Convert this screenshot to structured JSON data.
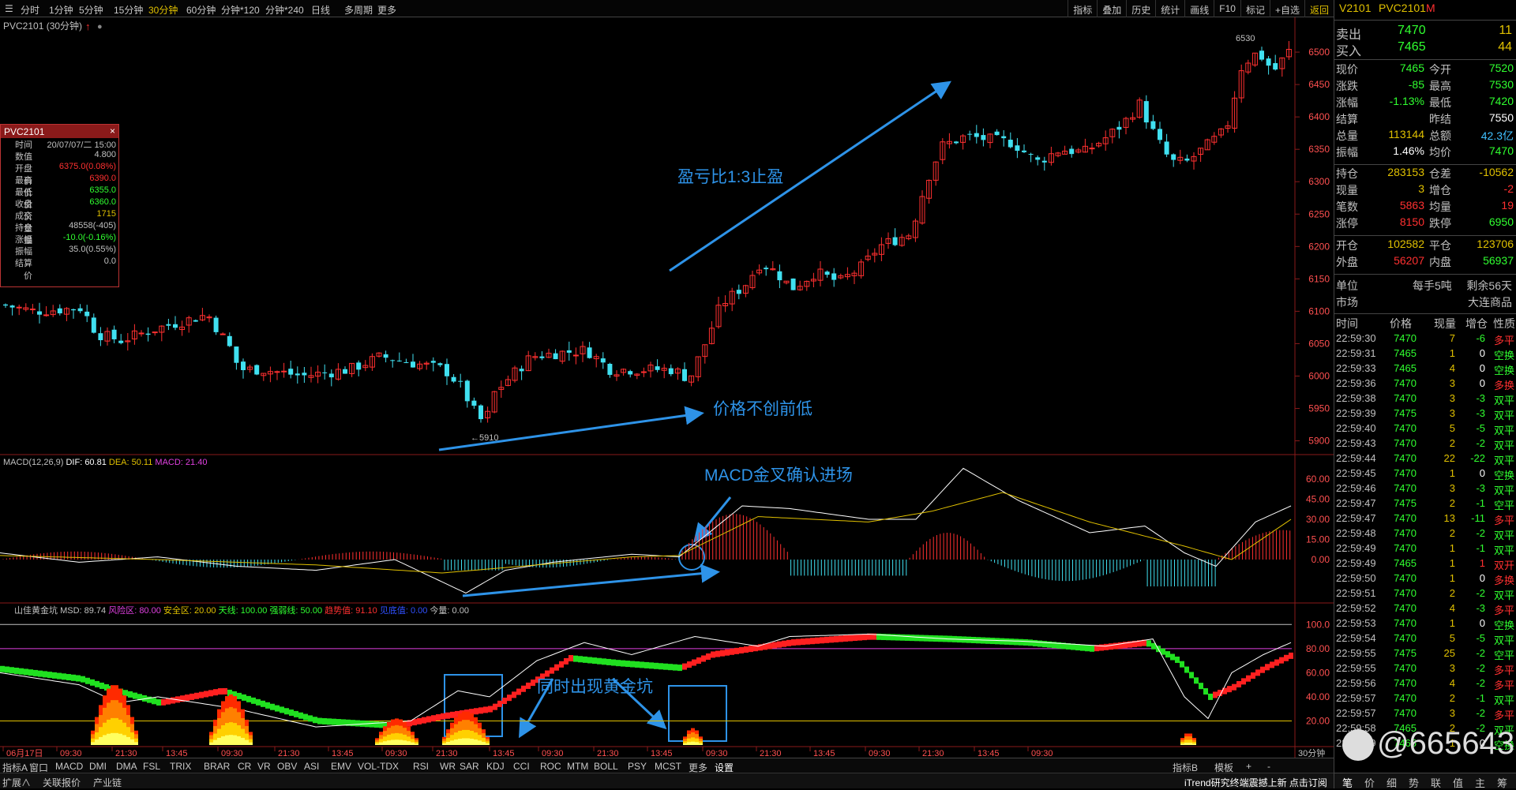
{
  "toolbar": {
    "periods": [
      "分时",
      "1分钟",
      "5分钟",
      "15分钟",
      "30分钟",
      "60分钟",
      "分钟*120",
      "分钟*240",
      "日线",
      "多周期",
      "更多"
    ],
    "active_period": "30分钟",
    "right_buttons": [
      "指标",
      "叠加",
      "历史",
      "统计",
      "画线",
      "F10",
      "标记",
      "+自选",
      "返回"
    ]
  },
  "main": {
    "title": "PVC2101 (30分钟)"
  },
  "info_box": {
    "title": "PVC2101",
    "close": "×",
    "rows": [
      {
        "k": "时间",
        "v": "20/07/07/二 15:00",
        "c": "#c0c0c0"
      },
      {
        "k": "数值",
        "v": "4.800",
        "c": "#c0c0c0"
      },
      {
        "k": "开盘价",
        "v": "6375.0(0.08%)",
        "c": "#ff3030"
      },
      {
        "k": "最高价",
        "v": "6390.0",
        "c": "#ff3030"
      },
      {
        "k": "最低价",
        "v": "6355.0",
        "c": "#30ff30"
      },
      {
        "k": "收盘价",
        "v": "6360.0",
        "c": "#30ff30"
      },
      {
        "k": "成交量",
        "v": "1715",
        "c": "#e0c000"
      },
      {
        "k": "持仓量",
        "v": "48558(-405)",
        "c": "#c0c0c0"
      },
      {
        "k": "涨幅",
        "v": "-10.0(-0.16%)",
        "c": "#30ff30"
      },
      {
        "k": "振幅",
        "v": "35.0(0.55%)",
        "c": "#c0c0c0"
      },
      {
        "k": "结算价",
        "v": "0.0",
        "c": "#c0c0c0"
      }
    ]
  },
  "annotations": {
    "target": "盈亏比1:3止盈",
    "no_new_low": "价格不创前低",
    "macd_cross": "MACD金叉确认进场",
    "golden_pit": "同时出现黄金坑"
  },
  "macd_legend": {
    "name": "MACD(12,26,9)",
    "dif": "DIF: 60.81",
    "dea": "DEA: 50.11",
    "macd": "MACD: 21.40"
  },
  "pit_legend": {
    "name": "山佳黄金坑",
    "msd": "MSD: 89.74",
    "risk": "风险区: 80.00",
    "safe": "安全区: 20.00",
    "sky": "天线: 100.00",
    "strong": "强弱线: 50.00",
    "trend": "趋势值: 91.10",
    "bottom": "见底值: 0.00",
    "vol": "今量: 0.00"
  },
  "price_axis": [
    "6500",
    "6450",
    "6400",
    "6350",
    "6300",
    "6250",
    "6200",
    "6150",
    "6100",
    "6050",
    "6000",
    "5950",
    "5900"
  ],
  "macd_axis": [
    "60.00",
    "45.00",
    "30.00",
    "15.00",
    "0.00"
  ],
  "pit_axis": [
    "100.0",
    "80.00",
    "60.00",
    "40.00",
    "20.00"
  ],
  "x_axis": [
    "06月17日",
    "09:30",
    "21:30",
    "13:45",
    "09:30",
    "21:30",
    "13:45",
    "09:30",
    "21:30",
    "13:45",
    "09:30",
    "21:30",
    "13:45",
    "09:30",
    "21:30",
    "13:45",
    "09:30",
    "21:30",
    "13:45",
    "09:30"
  ],
  "period_label": "30分钟",
  "markers": {
    "high": "6530",
    "low": "5910"
  },
  "chart_data": {
    "type": "candlestick",
    "price_ylim": [
      5880,
      6550
    ],
    "macd_ylim": [
      -30,
      70
    ],
    "pit_ylim": [
      0,
      110
    ],
    "high": 6530,
    "low": 5910
  },
  "indicator_tabs": [
    "指标A",
    "窗口",
    "MACD",
    "DMI",
    "DMA",
    "FSL",
    "TRIX",
    "BRAR",
    "CR",
    "VR",
    "OBV",
    "ASI",
    "EMV",
    "VOL-TDX",
    "RSI",
    "WR",
    "SAR",
    "KDJ",
    "CCI",
    "ROC",
    "MTM",
    "BOLL",
    "PSY",
    "MCST",
    "更多",
    "设置"
  ],
  "bottom_tabs": [
    "扩展∧",
    "关联报价",
    "产业链"
  ],
  "bottom_right": [
    "指标B",
    "模板",
    "+",
    "-"
  ],
  "status": "iTrend研究终端震撼上新 点击订阅",
  "right_panel": {
    "contract": "V2101",
    "name": "PVC2101",
    "tag": "M",
    "sell": {
      "label": "卖出",
      "price": "7470",
      "vol": "11"
    },
    "buy": {
      "label": "买入",
      "price": "7465",
      "vol": "44"
    },
    "quote": [
      [
        "现价",
        "7465",
        "今开",
        "7520"
      ],
      [
        "涨跌",
        "-85",
        "最高",
        "7530"
      ],
      [
        "涨幅",
        "-1.13%",
        "最低",
        "7420"
      ],
      [
        "结算",
        "",
        "昨结",
        "7550"
      ],
      [
        "总量",
        "113144",
        "总额",
        "42.3亿"
      ],
      [
        "振幅",
        "1.46%",
        "均价",
        "7470"
      ]
    ],
    "pos": [
      [
        "持仓",
        "283153",
        "仓差",
        "-10562"
      ],
      [
        "现量",
        "3",
        "增仓",
        "-2"
      ],
      [
        "笔数",
        "5863",
        "均量",
        "19"
      ],
      [
        "涨停",
        "8150",
        "跌停",
        "6950"
      ]
    ],
    "open": [
      [
        "开仓",
        "102582",
        "平仓",
        "123706"
      ],
      [
        "外盘",
        "56207",
        "内盘",
        "56937"
      ]
    ],
    "unit": {
      "k": "单位",
      "v": "每手5吨",
      "k2": "剩余56天"
    },
    "market": {
      "k": "市场",
      "v": "大连商品"
    },
    "tick_headers": [
      "时间",
      "价格",
      "现量",
      "增仓",
      "性质"
    ],
    "ticks": [
      [
        "22:59:30",
        "7470",
        "7",
        "-6",
        "多平"
      ],
      [
        "22:59:31",
        "7465",
        "1",
        "0",
        "空换"
      ],
      [
        "22:59:33",
        "7465",
        "4",
        "0",
        "空换"
      ],
      [
        "22:59:36",
        "7470",
        "3",
        "0",
        "多换"
      ],
      [
        "22:59:38",
        "7470",
        "3",
        "-3",
        "双平"
      ],
      [
        "22:59:39",
        "7475",
        "3",
        "-3",
        "双平"
      ],
      [
        "22:59:40",
        "7470",
        "5",
        "-5",
        "双平"
      ],
      [
        "22:59:43",
        "7470",
        "2",
        "-2",
        "双平"
      ],
      [
        "22:59:44",
        "7470",
        "22",
        "-22",
        "双平"
      ],
      [
        "22:59:45",
        "7470",
        "1",
        "0",
        "空换"
      ],
      [
        "22:59:46",
        "7470",
        "3",
        "-3",
        "双平"
      ],
      [
        "22:59:47",
        "7475",
        "2",
        "-1",
        "空平"
      ],
      [
        "22:59:47",
        "7470",
        "13",
        "-11",
        "多平"
      ],
      [
        "22:59:48",
        "7470",
        "2",
        "-2",
        "双平"
      ],
      [
        "22:59:49",
        "7470",
        "1",
        "-1",
        "双平"
      ],
      [
        "22:59:49",
        "7465",
        "1",
        "1",
        "双开"
      ],
      [
        "22:59:50",
        "7470",
        "1",
        "0",
        "多换"
      ],
      [
        "22:59:51",
        "7470",
        "2",
        "-2",
        "双平"
      ],
      [
        "22:59:52",
        "7470",
        "4",
        "-3",
        "多平"
      ],
      [
        "22:59:53",
        "7470",
        "1",
        "0",
        "空换"
      ],
      [
        "22:59:54",
        "7470",
        "5",
        "-5",
        "双平"
      ],
      [
        "22:59:55",
        "7475",
        "25",
        "-2",
        "空平"
      ],
      [
        "22:59:55",
        "7470",
        "3",
        "-2",
        "多平"
      ],
      [
        "22:59:56",
        "7470",
        "4",
        "-2",
        "多平"
      ],
      [
        "22:59:57",
        "7470",
        "2",
        "-1",
        "双平"
      ],
      [
        "22:59:57",
        "7470",
        "3",
        "-2",
        "多平"
      ],
      [
        "22:59:58",
        "7465",
        "2",
        "-2",
        "双平"
      ],
      [
        "22:59:59",
        "7465",
        "1",
        "0",
        "空换"
      ]
    ],
    "footer_tabs": [
      "笔",
      "价",
      "细",
      "势",
      "联",
      "值",
      "主",
      "筹"
    ]
  },
  "watermark": "@665643"
}
